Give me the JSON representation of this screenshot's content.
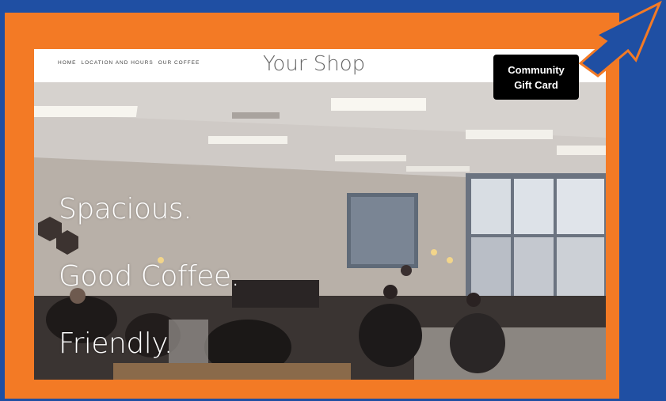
{
  "colors": {
    "page_background": "#1f4fa3",
    "frame": "#f37a25",
    "arrow_fill": "#1f4fa3",
    "arrow_outline": "#f37a25",
    "callout_bg": "#000000",
    "callout_text": "#ffffff"
  },
  "site": {
    "nav": [
      "HOME",
      "LOCATION AND HOURS",
      "OUR COFFEE"
    ],
    "brand": "Your Shop"
  },
  "hero": {
    "lines": [
      "Spacious.",
      "Good Coffee.",
      "Friendly."
    ],
    "image": "cafe interior photo"
  },
  "callout": {
    "label": "Community\nGift Card",
    "icon": "arrow-pointer-icon"
  }
}
